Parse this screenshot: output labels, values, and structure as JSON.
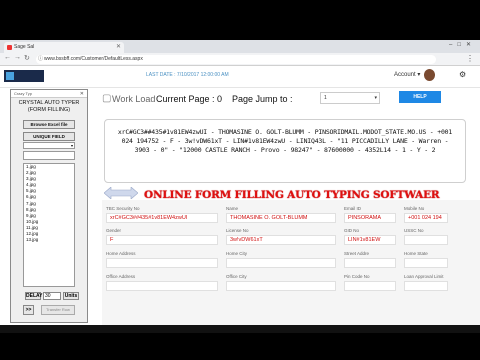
{
  "browser": {
    "tab_title": "Sage Sal",
    "url": "www.bssbff.com/Customer/DefaultLess.aspx"
  },
  "header": {
    "last_date": "LAST DATE : 7/10/2017 12:00:00 AM",
    "account_label": "Account ▾"
  },
  "workload": {
    "title": "Work Load",
    "current_page": "Current Page : 0",
    "page_jump": "Page Jump to :",
    "jump_value": "1",
    "help": "HELP"
  },
  "record_text": "xrC#GC3##435#1v81EW4zwUI - THOMASINE O. GOLT-BLUMM - PINSORIDMAIL.MODOT_STATE.MO.US - +001 024 194752 - F - 3w!vDW61xT - LIN#1v81EW4zwU - LINIQ43L - \"11 PICCADILLY LANE - Warren - 3903 - 0\" - \"12000 CASTLE RANCH - Provo - 98247\" - 87600000 - 4352L14 - 1 - Y - 2",
  "banner": "ONLINE FORM FILLING AUTO TYPING SOFTWAER",
  "form": {
    "fields": [
      {
        "label": "TBC Security No",
        "value": "xrC#GC3##435#1v81EW4zwUI"
      },
      {
        "label": "Name",
        "value": "THOMASINE O. GOLT-BLUMM"
      },
      {
        "label": "Email ID",
        "value": "PINSORAMA"
      },
      {
        "label": "Mobile No",
        "value": "+001 024 194"
      },
      {
        "label": "Gender",
        "value": "F"
      },
      {
        "label": "License No",
        "value": "3w!vDW61xT"
      },
      {
        "label": "GID No",
        "value": "LIN#1v81EW"
      },
      {
        "label": "USSC No",
        "value": ""
      },
      {
        "label": "Home Address",
        "value": ""
      },
      {
        "label": "Home City",
        "value": ""
      },
      {
        "label": "Street Addre",
        "value": ""
      },
      {
        "label": "Home State",
        "value": ""
      },
      {
        "label": "Office Address",
        "value": ""
      },
      {
        "label": "Office City",
        "value": ""
      },
      {
        "label": "Pin Code No",
        "value": ""
      },
      {
        "label": "Loan Approval Limit",
        "value": ""
      }
    ]
  },
  "typer": {
    "window_title": "Crazy Typ",
    "heading": "CRYSTAL AUTO TYPER (FORM FILLING)",
    "browse_label": "Browse Excel file",
    "unique_label": "UNIQUE FIELD",
    "files": [
      "1.jpg",
      "2.jpg",
      "3.jpg",
      "4.jpg",
      "5.jpg",
      "6.jpg",
      "7.jpg",
      "8.jpg",
      "9.jpg",
      "10.jpg",
      "11.jpg",
      "12.jpg",
      "13.jpg"
    ],
    "delay_label": "DELAY",
    "delay_value": "30",
    "delay_unit": "Units",
    "go_label": ">>",
    "transfer_label": "Transfer Row"
  },
  "colors": {
    "accent": "#1e88e5",
    "banner": "#e01010",
    "input_text": "#d01010"
  }
}
